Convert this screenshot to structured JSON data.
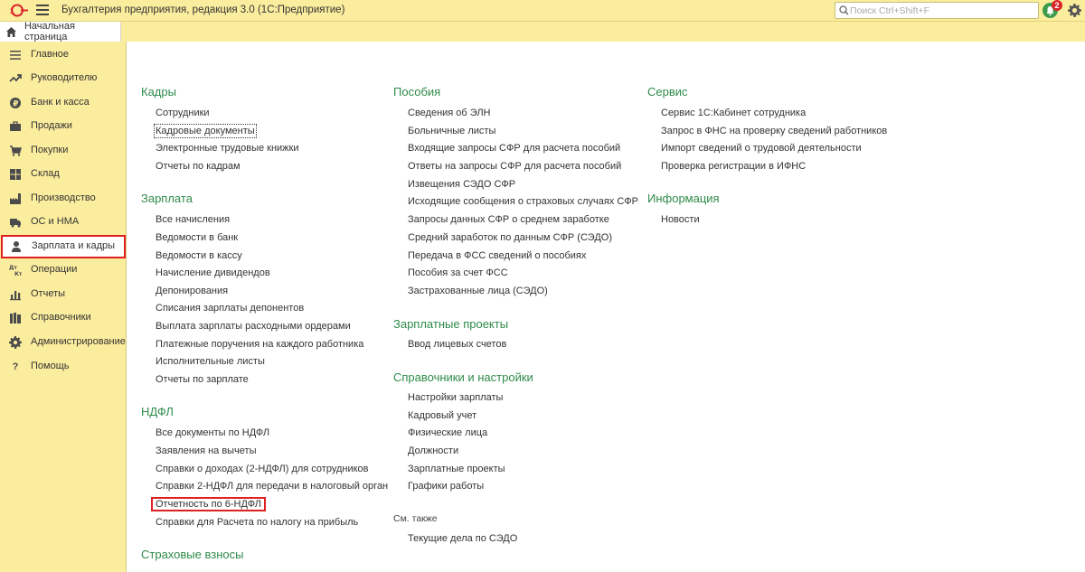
{
  "app": {
    "title": "Бухгалтерия предприятия, редакция 3.0  (1С:Предприятие)",
    "search_placeholder": "Поиск Ctrl+Shift+F",
    "notifications_count": "2",
    "accent_color": "#2e8b49",
    "panel_color": "#fbed9e",
    "highlight_color": "#e02020"
  },
  "tabs": {
    "home_label": "Начальная страница"
  },
  "sidebar": {
    "items": [
      {
        "label": "Главное",
        "icon": "menu-lines-icon"
      },
      {
        "label": "Руководителю",
        "icon": "trend-up-icon"
      },
      {
        "label": "Банк и касса",
        "icon": "ruble-coin-icon"
      },
      {
        "label": "Продажи",
        "icon": "briefcase-icon"
      },
      {
        "label": "Покупки",
        "icon": "cart-icon"
      },
      {
        "label": "Склад",
        "icon": "warehouse-grid-icon"
      },
      {
        "label": "Производство",
        "icon": "factory-icon"
      },
      {
        "label": "ОС и НМА",
        "icon": "truck-icon"
      },
      {
        "label": "Зарплата и кадры",
        "icon": "person-icon"
      },
      {
        "label": "Операции",
        "icon": "dt-kt-icon"
      },
      {
        "label": "Отчеты",
        "icon": "bar-chart-icon"
      },
      {
        "label": "Справочники",
        "icon": "books-icon"
      },
      {
        "label": "Администрирование",
        "icon": "gear-icon"
      },
      {
        "label": "Помощь",
        "icon": "question-icon"
      }
    ]
  },
  "columns": {
    "col1": {
      "kadry": {
        "title": "Кадры",
        "links": [
          "Сотрудники",
          "Кадровые документы",
          "Электронные трудовые книжки",
          "Отчеты по кадрам"
        ]
      },
      "zarplata": {
        "title": "Зарплата",
        "links": [
          "Все начисления",
          "Ведомости в банк",
          "Ведомости в кассу",
          "Начисление дивидендов",
          "Депонирования",
          "Списания зарплаты депонентов",
          "Выплата зарплаты расходными ордерами",
          "Платежные поручения на каждого работника",
          "Исполнительные листы",
          "Отчеты по зарплате"
        ]
      },
      "ndfl": {
        "title": "НДФЛ",
        "links": [
          "Все документы по НДФЛ",
          "Заявления на вычеты",
          "Справки о доходах (2-НДФЛ) для сотрудников",
          "Справки 2-НДФЛ для передачи в налоговый орган",
          "Отчетность по 6-НДФЛ",
          "Справки для Расчета по налогу на прибыль"
        ]
      },
      "strakh": {
        "title": "Страховые взносы"
      }
    },
    "col2": {
      "posobiya": {
        "title": "Пособия",
        "links": [
          "Сведения об ЭЛН",
          "Больничные листы",
          "Входящие запросы СФР для расчета пособий",
          "Ответы на запросы СФР для расчета пособий",
          "Извещения СЭДО СФР",
          "Исходящие сообщения о страховых случаях СФР",
          "Запросы данных СФР о среднем заработке",
          "Средний заработок по данным СФР (СЭДО)",
          "Передача в ФСС сведений о пособиях",
          "Пособия за счет ФСС",
          "Застрахованные лица (СЭДО)"
        ]
      },
      "proekty": {
        "title": "Зарплатные проекты",
        "links": [
          "Ввод лицевых счетов"
        ]
      },
      "sprav": {
        "title": "Справочники и настройки",
        "links": [
          "Настройки зарплаты",
          "Кадровый учет",
          "Физические лица",
          "Должности",
          "Зарплатные проекты",
          "Графики работы"
        ]
      },
      "see_also": {
        "title": "См. также",
        "links": [
          "Текущие дела по СЭДО"
        ]
      }
    },
    "col3": {
      "servis": {
        "title": "Сервис",
        "links": [
          "Сервис 1С:Кабинет сотрудника",
          "Запрос в ФНС на проверку сведений работников",
          "Импорт сведений о трудовой деятельности",
          "Проверка регистрации в ИФНС"
        ]
      },
      "info": {
        "title": "Информация",
        "links": [
          "Новости"
        ]
      }
    }
  }
}
